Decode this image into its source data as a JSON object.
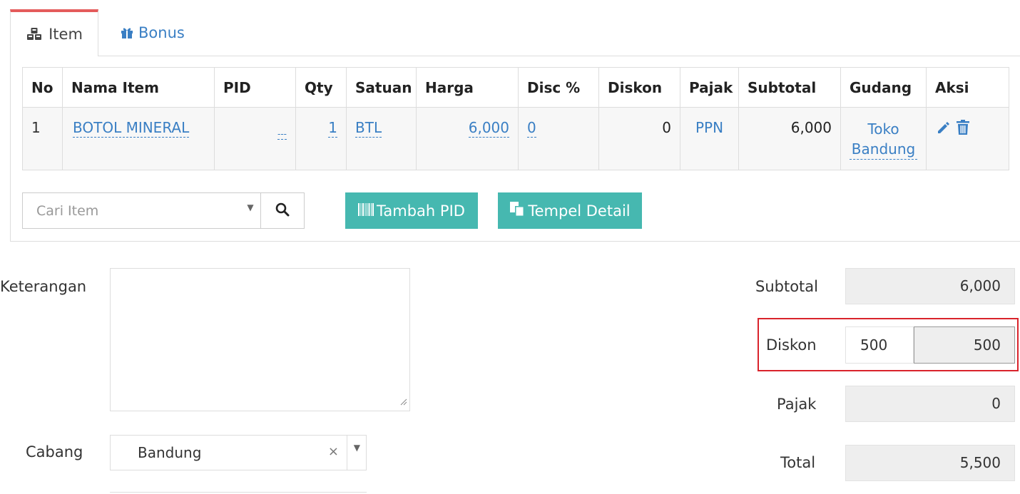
{
  "tabs": [
    {
      "label": "Item",
      "icon": "cubes-icon",
      "active": true
    },
    {
      "label": "Bonus",
      "icon": "gift-icon",
      "active": false
    }
  ],
  "table": {
    "headers": [
      "No",
      "Nama Item",
      "PID",
      "Qty",
      "Satuan",
      "Harga",
      "Disc %",
      "Diskon",
      "Pajak",
      "Subtotal",
      "Gudang",
      "Aksi"
    ],
    "rows": [
      {
        "no": "1",
        "nama_item": "BOTOL MINERAL",
        "pid": "---",
        "qty": "1",
        "satuan": "BTL",
        "harga": "6,000",
        "disc_pct": "0",
        "diskon": "0",
        "pajak": "PPN",
        "subtotal": "6,000",
        "gudang": "Toko Bandung"
      }
    ]
  },
  "search": {
    "placeholder": "Cari Item"
  },
  "buttons": {
    "tambah_pid": "Tambah PID",
    "tempel_detail": "Tempel Detail"
  },
  "form": {
    "keterangan_label": "Keterangan",
    "cabang_label": "Cabang",
    "cabang_value": "Bandung",
    "clear_symbol": "×"
  },
  "summary": {
    "subtotal_label": "Subtotal",
    "subtotal_value": "6,000",
    "diskon_label": "Diskon",
    "diskon_input": "500",
    "diskon_value": "500",
    "pajak_label": "Pajak",
    "pajak_value": "0",
    "total_label": "Total",
    "total_value": "5,500"
  },
  "colors": {
    "teal": "#46b8b0",
    "link_blue": "#3a7fc4",
    "tab_active_red": "#e45b5b",
    "highlight_red": "#d9232b"
  }
}
